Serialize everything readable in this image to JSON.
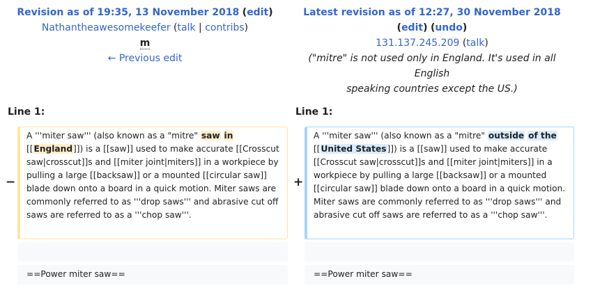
{
  "left_header": {
    "title_prefix": "Revision as of 19:35, 13 November 2018",
    "edit_label": "edit",
    "user_name": "Nathantheawesomekeefer",
    "talk_label": "talk",
    "sep": "|",
    "contribs_label": "contribs",
    "minor_flag": "m",
    "prev_edit": "← Previous edit"
  },
  "right_header": {
    "title_prefix": "Latest revision as of 12:27, 30 November 2018",
    "edit_label": "edit",
    "undo_label": "undo",
    "ip_address": "131.137.245.209",
    "talk_label": "talk",
    "summary_line1": "(\"mitre\" is not used only in England. It's used in all English",
    "summary_line2": "speaking countries except the US.)"
  },
  "diff": {
    "line_label_left": "Line 1:",
    "line_label_right": "Line 1:",
    "minus_marker": "−",
    "plus_marker": "+",
    "left_text": {
      "a": "A '''miter saw''' (also known as a \"mitre\" ",
      "b": "saw",
      "c": " ",
      "d": "in",
      "e": " [[",
      "f": "England",
      "g": "]]) is a [[saw]] used to make accurate [[Crosscut saw|crosscut]]s and [[miter joint|miters]] in a workpiece by pulling a large [[backsaw]] or a mounted [[circular saw]] blade down onto a board in a quick motion. Miter saws are commonly referred to as '''drop saws''' and abrasive cut off saws are referred to as a '''chop saw'''."
    },
    "right_text": {
      "a": "A '''miter saw''' (also known as a \"mitre\" ",
      "b": "outside",
      "c": " ",
      "d": "of the",
      "e": " [[",
      "f": "United States",
      "g": "]]) is a [[saw]] used to make accurate [[Crosscut saw|crosscut]]s and [[miter joint|miters]] in a workpiece by pulling a large [[backsaw]] or a mounted [[circular saw]] blade down onto a board in a quick motion. Miter saws are commonly referred to as '''drop saws''' and abrasive cut off saws are referred to as a '''chop saw'''."
    },
    "context_empty": "",
    "context_heading": "==Power miter saw=="
  }
}
